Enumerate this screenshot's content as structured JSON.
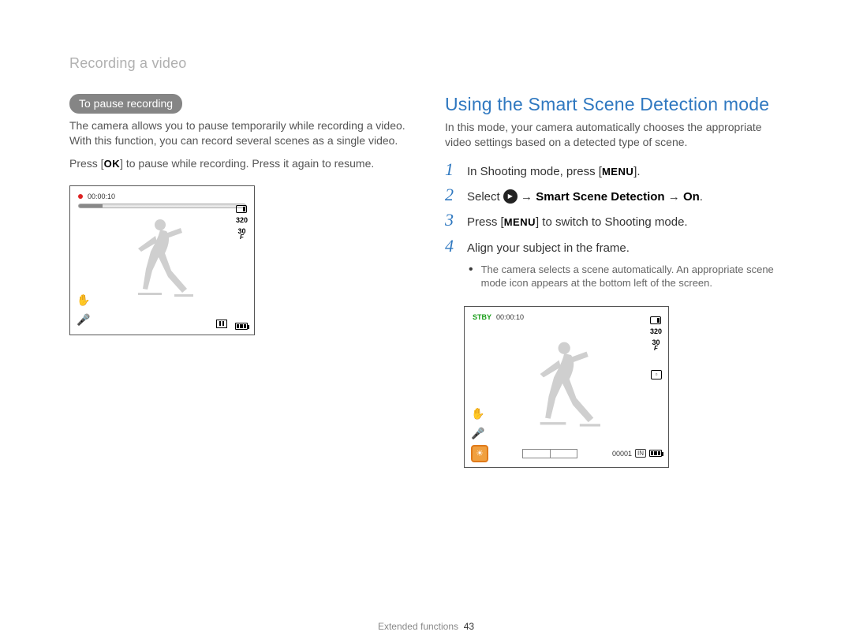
{
  "breadcrumb": "Recording a video",
  "left": {
    "pill": "To pause recording",
    "para1": "The camera allows you to pause temporarily while recording a video. With this function, you can record several scenes as a single video.",
    "para2_prefix": "Press [",
    "para2_ok": "OK",
    "para2_suffix": "] to pause while recording. Press it again to resume.",
    "screen": {
      "time": "00:00:10",
      "res": "320",
      "fps": "30",
      "fps_sub": "F"
    }
  },
  "right": {
    "heading": "Using the Smart Scene Detection mode",
    "intro": "In this mode, your camera automatically chooses the appropriate video settings based on a detected type of scene.",
    "steps": {
      "s1_num": "1",
      "s1_a": "In Shooting mode, press [",
      "s1_menu": "MENU",
      "s1_b": "].",
      "s2_num": "2",
      "s2_a": "Select ",
      "s2_b": " → ",
      "s2_bold1": "Smart Scene Detection",
      "s2_c": " → ",
      "s2_bold2": "On",
      "s2_d": ".",
      "s3_num": "3",
      "s3_a": "Press [",
      "s3_menu": "MENU",
      "s3_b": "] to switch to Shooting mode.",
      "s4_num": "4",
      "s4_text": "Align your subject in the frame.",
      "s4_bullet": "The camera selects a scene automatically. An appropriate scene mode icon appears at the bottom left of the screen."
    },
    "screen": {
      "stby": "STBY",
      "time": "00:00:10",
      "res": "320",
      "fps": "30",
      "fps_sub": "F",
      "counter": "00001",
      "in": "IN"
    }
  },
  "footer": {
    "section": "Extended functions",
    "page": "43"
  }
}
